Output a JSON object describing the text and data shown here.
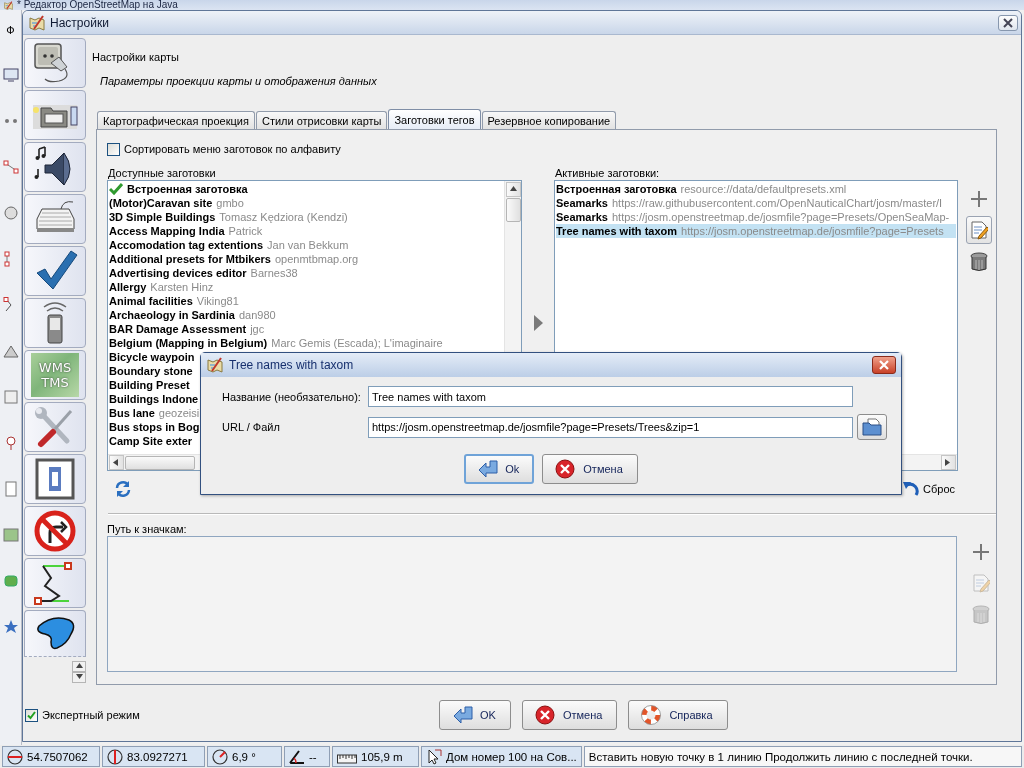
{
  "background_window": {
    "title": "* Редактор OpenStreetMap на Java",
    "menu_fragment": "Ф"
  },
  "window": {
    "title": "Настройки"
  },
  "sidebar": {
    "items": [
      {
        "kind": "plugin"
      },
      {
        "kind": "display"
      },
      {
        "kind": "audio"
      },
      {
        "kind": "shortcuts"
      },
      {
        "kind": "validator"
      },
      {
        "kind": "remote"
      },
      {
        "kind": "imagery",
        "lines": [
          "WMS",
          "TMS"
        ]
      },
      {
        "kind": "advanced"
      },
      {
        "kind": "projection"
      },
      {
        "kind": "restriction"
      },
      {
        "kind": "line"
      },
      {
        "kind": "area"
      }
    ]
  },
  "page": {
    "title": "Настройки карты",
    "subtitle": "Параметры проекции карты и отображения данных"
  },
  "tabs": [
    {
      "label": "Картографическая проекция",
      "selected": false
    },
    {
      "label": "Стили отрисовки карты",
      "selected": false
    },
    {
      "label": "Заготовки тегов",
      "selected": true
    },
    {
      "label": "Резервное копирование",
      "selected": false
    }
  ],
  "presets": {
    "sort_checkbox": {
      "label": "Сортировать меню заготовок по алфавиту",
      "checked": false
    },
    "available": {
      "label": "Доступные заготовки",
      "items": [
        {
          "name": "Встроенная заготовка",
          "active": true
        },
        {
          "name": "(Motor)Caravan site",
          "author": "gmbo",
          "active": false
        },
        {
          "name": "3D Simple Buildings",
          "author": "Tomasz Kędziora (Kendzi)",
          "active": false
        },
        {
          "name": "Access Mapping India",
          "author": "Patrick",
          "active": false
        },
        {
          "name": "Accomodation tag extentions",
          "author": "Jan van Bekkum",
          "active": false
        },
        {
          "name": "Additional presets for Mtbikers",
          "author": "openmtbmap.org",
          "active": false
        },
        {
          "name": "Advertising devices editor",
          "author": "Barnes38",
          "active": false
        },
        {
          "name": "Allergy",
          "author": "Karsten Hinz",
          "active": false
        },
        {
          "name": "Animal facilities",
          "author": "Viking81",
          "active": false
        },
        {
          "name": "Archaeology in Sardinia",
          "author": "dan980",
          "active": false
        },
        {
          "name": "BAR Damage Assessment",
          "author": "jgc",
          "active": false
        },
        {
          "name": "Belgium (Mapping in Belgium)",
          "author": "Marc Gemis (Escada); L'imaginaire",
          "active": false
        },
        {
          "name": "Bicycle waypoin",
          "active": false
        },
        {
          "name": "Boundary stone",
          "active": false
        },
        {
          "name": "Building Preset",
          "active": false
        },
        {
          "name": "Buildings Indone",
          "active": false
        },
        {
          "name": "Bus lane",
          "author": "geozeisi",
          "active": false
        },
        {
          "name": "Bus stops in Bog",
          "active": false
        },
        {
          "name": "Camp Site exter",
          "active": false
        }
      ]
    },
    "active": {
      "label": "Активные заготовки:",
      "items": [
        {
          "name": "Встроенная заготовка",
          "source": "resource://data/defaultpresets.xml",
          "selected": false
        },
        {
          "name": "Seamarks",
          "source": "https://raw.githubusercontent.com/OpenNauticalChart/josm/master/I",
          "selected": false
        },
        {
          "name": "Seamarks",
          "source": "https://josm.openstreetmap.de/josmfile?page=Presets/OpenSeaMap-",
          "selected": false
        },
        {
          "name": "Tree names with taxom",
          "source": "https://josm.openstreetmap.de/josmfile?page=Presets",
          "selected": true
        }
      ],
      "tools": [
        {
          "kind": "add",
          "disabled": false,
          "highlighted": false
        },
        {
          "kind": "edit",
          "disabled": false,
          "highlighted": true
        },
        {
          "kind": "delete",
          "disabled": false,
          "highlighted": false
        }
      ]
    },
    "reset": "Сброс"
  },
  "icon_paths": {
    "label": "Путь к значкам:",
    "tools": [
      {
        "kind": "add",
        "disabled": false,
        "highlighted": false
      },
      {
        "kind": "edit",
        "disabled": true,
        "highlighted": false
      },
      {
        "kind": "delete",
        "disabled": true,
        "highlighted": false
      }
    ]
  },
  "expert_mode": {
    "label": "Экспертный режим",
    "checked": true
  },
  "buttons": [
    {
      "label": "OK",
      "kind": "ok"
    },
    {
      "label": "Отмена",
      "kind": "cancel"
    },
    {
      "label": "Справка",
      "kind": "help"
    }
  ],
  "dialog": {
    "title": "Tree names with taxom",
    "fields": [
      {
        "label": "Название (необязательно):",
        "value": "Tree names with taxom",
        "kind": "text"
      },
      {
        "label": "URL / Файл",
        "value": "https://josm.openstreetmap.de/josmfile?page=Presets/Trees&zip=1",
        "kind": "file"
      }
    ],
    "buttons": [
      {
        "label": "Ok",
        "kind": "ok",
        "focused": true
      },
      {
        "label": "Отмена",
        "kind": "cancel",
        "focused": false
      }
    ]
  },
  "status_bar": [
    {
      "kind": "lat",
      "text": "54.7507062"
    },
    {
      "kind": "lon",
      "text": "83.0927271"
    },
    {
      "kind": "heading",
      "text": "6,9 °"
    },
    {
      "kind": "angle",
      "text": "--"
    },
    {
      "kind": "distance",
      "text": "105,9 m"
    },
    {
      "kind": "object",
      "text": "Дом номер 100 на Сов..."
    },
    {
      "kind": "help",
      "text": "Вставить новую точку в 1 линию Продолжить линию с последней точки."
    }
  ]
}
